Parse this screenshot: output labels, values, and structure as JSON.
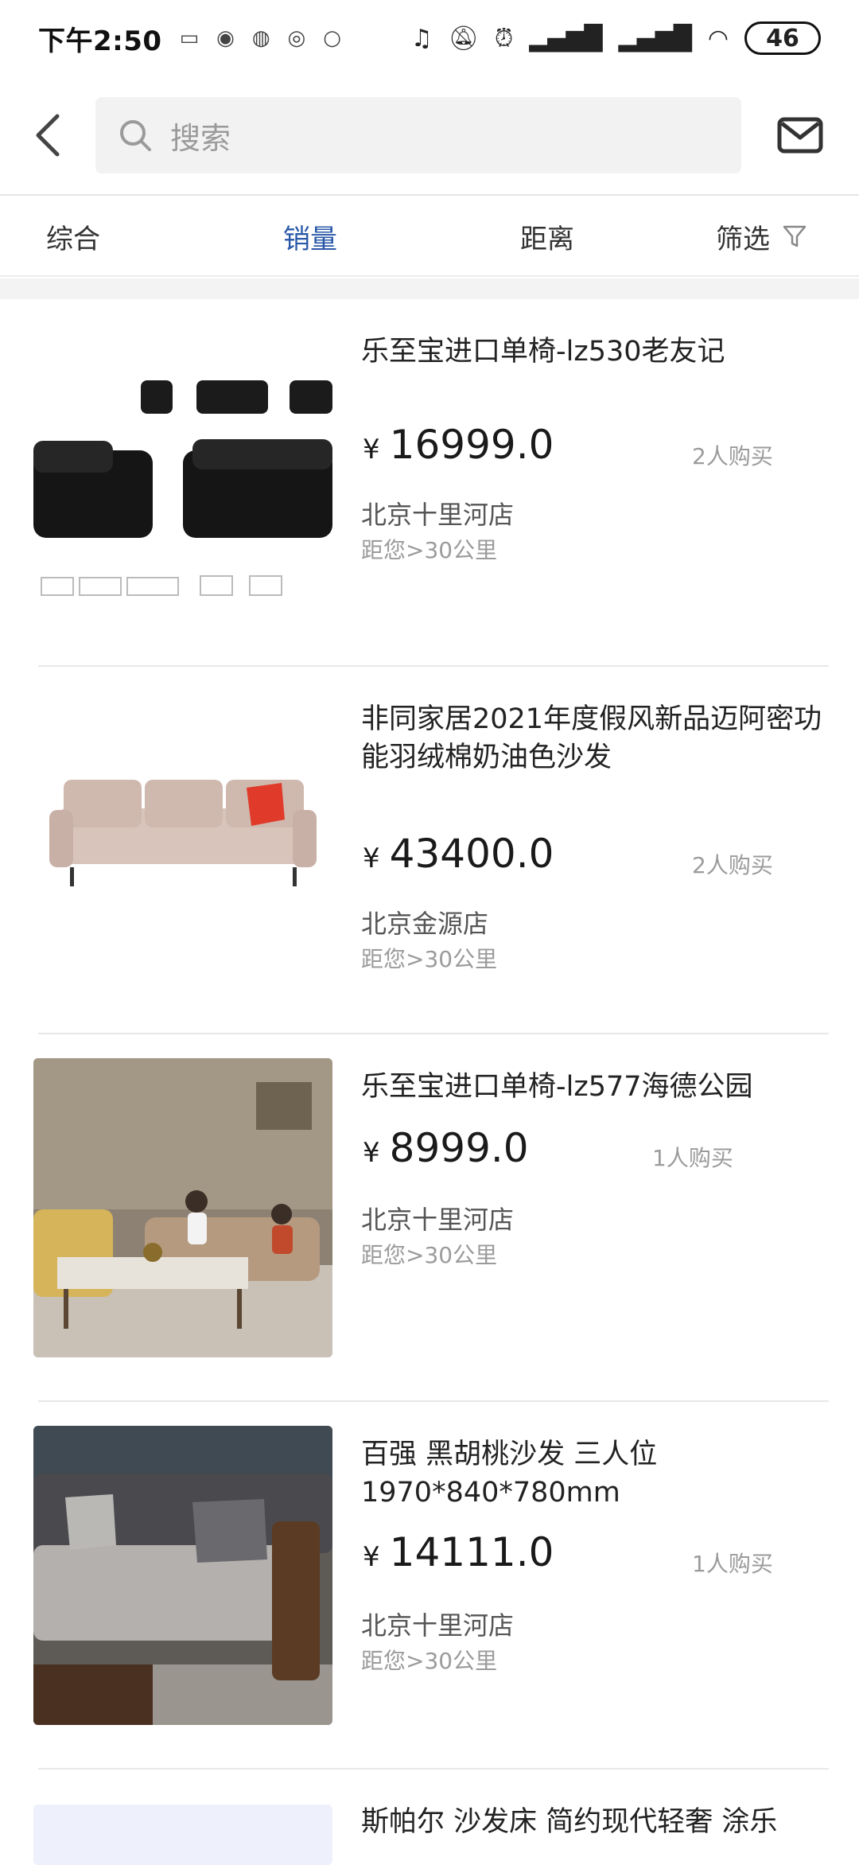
{
  "status_bar": {
    "time": "下午2:50",
    "battery": "46"
  },
  "search": {
    "placeholder": "搜索"
  },
  "tabs": [
    {
      "label": "综合"
    },
    {
      "label": "销量"
    },
    {
      "label": "距离"
    },
    {
      "label": "筛选"
    }
  ],
  "products": [
    {
      "title": "乐至宝进口单椅-lz530老友记",
      "price": "16999.0",
      "sold": "2人购买",
      "store": "北京十里河店",
      "distance": "距您>30公里"
    },
    {
      "title": "非同家居2021年度假风新品迈阿密功能羽绒棉奶油色沙发",
      "price": "43400.0",
      "sold": "2人购买",
      "store": "北京金源店",
      "distance": "距您>30公里"
    },
    {
      "title": "乐至宝进口单椅-lz577海德公园",
      "price": "8999.0",
      "sold": "1人购买",
      "store": "北京十里河店",
      "distance": "距您>30公里"
    },
    {
      "title": "百强 黑胡桃沙发 三人位 1970*840*780mm",
      "price": "14111.0",
      "sold": "1人购买",
      "store": "北京十里河店",
      "distance": "距您>30公里"
    },
    {
      "title": "斯帕尔 沙发床 简约现代轻奢 涂乐"
    }
  ],
  "currency_symbol": "¥",
  "colors": {
    "active_tab": "#2a58a8",
    "muted_text": "#9b9b9b"
  }
}
